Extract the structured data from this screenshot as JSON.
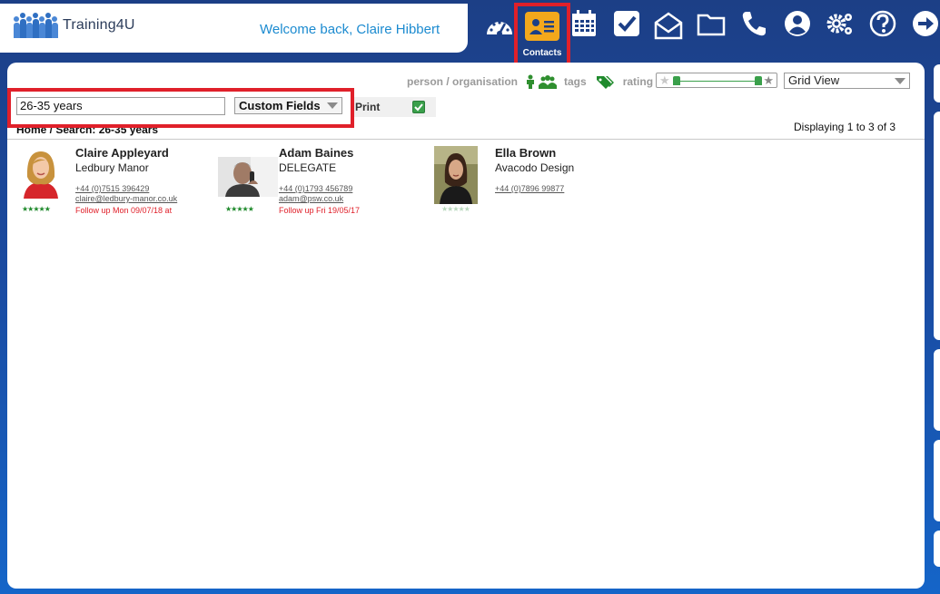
{
  "header": {
    "logo_text": "Training4U",
    "welcome": "Welcome back, Claire Hibbert"
  },
  "nav": {
    "items": [
      {
        "name": "dashboard-icon"
      },
      {
        "name": "contacts-icon",
        "label": "Contacts",
        "active": true
      },
      {
        "name": "calendar-icon"
      },
      {
        "name": "tasks-check-icon"
      },
      {
        "name": "mail-icon"
      },
      {
        "name": "folder-icon"
      },
      {
        "name": "phone-icon"
      },
      {
        "name": "user-profile-icon"
      },
      {
        "name": "settings-gears-icon"
      },
      {
        "name": "help-icon"
      },
      {
        "name": "logout-arrow-icon"
      }
    ],
    "contacts_label": "Contacts"
  },
  "filters": {
    "person_org_label": "person / organisation",
    "tags_label": "tags",
    "rating_label": "rating",
    "view_selected": "Grid View"
  },
  "search": {
    "value": "26-35 years",
    "field_select": "Custom Fields",
    "print_label": "Print",
    "print_checked": true
  },
  "breadcrumb": "Home / Search: 26-35 years",
  "displaying": "Displaying 1 to 3 of 3",
  "contacts": [
    {
      "name": "Claire Appleyard",
      "org": "Ledbury Manor",
      "phone": "+44 (0)7515 396429",
      "email": "claire@ledbury-manor.co.uk",
      "follow_up": "Follow up Mon 09/07/18 at",
      "stars": "★★★★★",
      "rating": 5
    },
    {
      "name": "Adam Baines",
      "org": "DELEGATE",
      "phone": "+44 (0)1793 456789",
      "email": "adam@psw.co.uk",
      "follow_up": "Follow up Fri 19/05/17",
      "stars": "★★★★★",
      "rating": 5
    },
    {
      "name": "Ella Brown",
      "org": "Avacodo Design",
      "phone": "+44 (0)7896 99877",
      "email": "",
      "follow_up": "",
      "stars": "★★★★★",
      "rating": 0
    }
  ],
  "colors": {
    "brand_blue": "#1c3f86",
    "highlight_red": "#e0202a",
    "accent_orange": "#f3a81c",
    "star_green": "#1f8a2c",
    "follow_up_red": "#e0202a"
  }
}
